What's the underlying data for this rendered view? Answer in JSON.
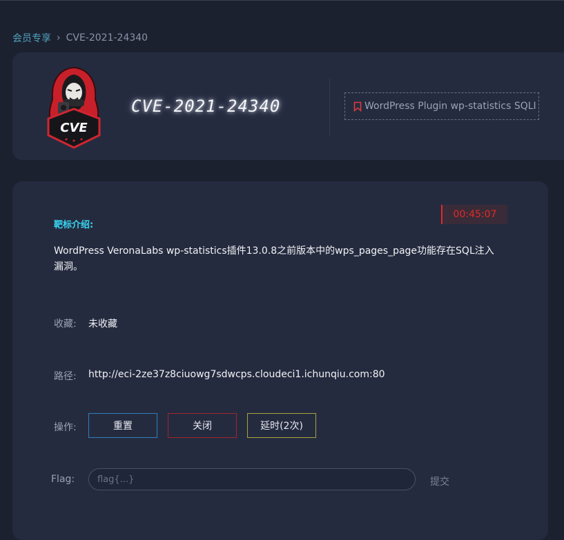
{
  "breadcrumb": {
    "parent": "会员专享",
    "separator": "›",
    "current": "CVE-2021-24340"
  },
  "header": {
    "logo_text": "CVE",
    "title": "CVE-2021-24340",
    "tag_icon": "bookmark-icon",
    "tag_label": "WordPress Plugin wp-statistics SQLI"
  },
  "main": {
    "timer": "00:45:07",
    "intro_title": "靶标介绍:",
    "description": "WordPress VeronaLabs wp-statistics插件13.0.8之前版本中的wps_pages_page功能存在SQL注入漏洞。",
    "favorite_label": "收藏:",
    "favorite_value": "未收藏",
    "path_label": "路径:",
    "path_value": "http://eci-2ze37z8ciuowg7sdwcps.cloudeci1.ichunqiu.com:80",
    "ops_label": "操作:",
    "buttons": {
      "reset": "重置",
      "close": "关闭",
      "delay": "延时(2次)"
    },
    "flag_label": "Flag:",
    "flag_placeholder": "flag{...}",
    "submit_label": "提交"
  },
  "colors": {
    "background": "#1c2130",
    "card": "#252b3f",
    "accent_cyan": "#38d6f2",
    "timer_red": "#e02a2a",
    "reset_border": "#2f7fba",
    "close_border": "#a0252c",
    "delay_border": "#a8a43a"
  }
}
